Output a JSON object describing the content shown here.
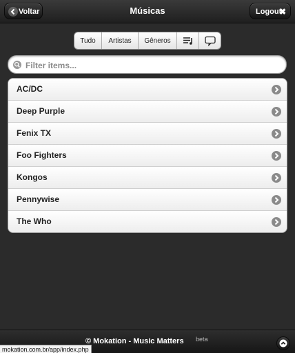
{
  "header": {
    "back_label": "Voltar",
    "title": "Músicas",
    "logout_label": "Logout"
  },
  "tabs": [
    {
      "label": "Tudo"
    },
    {
      "label": "Artistas"
    },
    {
      "label": "Gêneros"
    },
    {
      "icon": "playlist-icon"
    },
    {
      "icon": "chat-bubble-icon"
    }
  ],
  "search": {
    "placeholder": "Filter items...",
    "value": ""
  },
  "list": {
    "items": [
      {
        "label": "AC/DC"
      },
      {
        "label": "Deep Purple"
      },
      {
        "label": "Fenix TX"
      },
      {
        "label": "Foo Fighters"
      },
      {
        "label": "Kongos"
      },
      {
        "label": "Pennywise"
      },
      {
        "label": "The Who"
      }
    ]
  },
  "footer": {
    "text": "© Mokation - Music Matters",
    "beta": "beta"
  },
  "status": {
    "url": "mokation.com.br/app/index.php"
  },
  "colors": {
    "background": "#2b2b2b",
    "header": "#1f1f1f",
    "list_background": "#ffffff",
    "arrow": "#8a8a8a"
  }
}
